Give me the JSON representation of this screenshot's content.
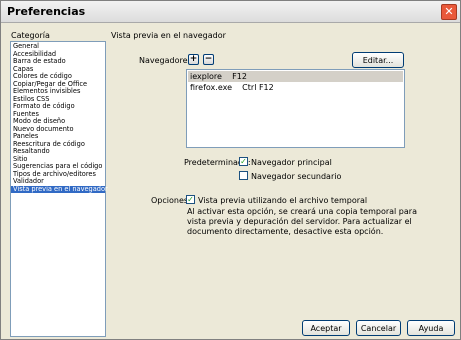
{
  "window": {
    "title": "Preferencias",
    "close": "✕"
  },
  "categories": {
    "label": "Categoría",
    "items": [
      "General",
      "Accesibilidad",
      "Barra de estado",
      "Capas",
      "Colores de código",
      "Copiar/Pegar de Office",
      "Elementos invisibles",
      "Estilos CSS",
      "Formato de código",
      "Fuentes",
      "Modo de diseño",
      "Nuevo documento",
      "Paneles",
      "Reescritura de código",
      "Resaltando",
      "Sitio",
      "Sugerencias para el código",
      "Tipos de archivo/editores",
      "Validador",
      "Vista previa en el navegador"
    ],
    "selected_index": 19
  },
  "panel": {
    "title": "Vista previa en el navegador",
    "browsers_label": "Navegadores:",
    "add": "+",
    "remove": "−",
    "edit": "Editar...",
    "browsers": [
      "iexplore    F12",
      "firefox.exe    Ctrl F12"
    ],
    "default_label": "Predeterminado:",
    "primary": "Navegador principal",
    "secondary": "Navegador secundario",
    "options_label": "Opciones:",
    "temp_file": "Vista previa utilizando el archivo temporal",
    "description": "Al activar esta opción, se creará una copia temporal para vista previa y depuración del servidor. Para actualizar el documento directamente, desactive esta opción.",
    "checks": {
      "primary": true,
      "secondary": false,
      "temp_file": true
    }
  },
  "footer": {
    "ok": "Aceptar",
    "cancel": "Cancelar",
    "help": "Ayuda"
  }
}
